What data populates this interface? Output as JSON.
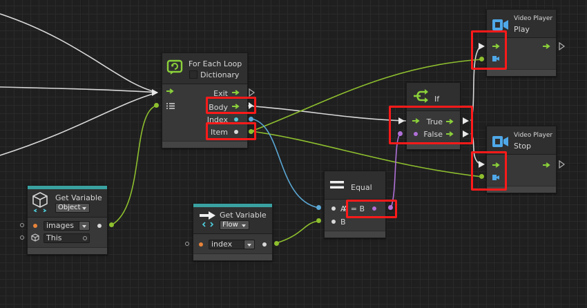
{
  "nodes": {
    "for_each": {
      "title": "For Each Loop",
      "dictionary_label": "Dictionary",
      "exit": "Exit",
      "body": "Body",
      "index": "Index",
      "item": "Item"
    },
    "get_var_object": {
      "title": "Get Variable",
      "kind": "Object",
      "name": "images",
      "target": "This"
    },
    "get_var_flow": {
      "title": "Get Variable",
      "kind": "Flow",
      "name": "index"
    },
    "equal": {
      "title": "Equal",
      "a": "A",
      "b": "B",
      "result": "A = B"
    },
    "if": {
      "title": "If",
      "true_label": "True",
      "false_label": "False"
    },
    "video_play": {
      "subtitle": "Video Player",
      "title": "Play"
    },
    "video_stop": {
      "subtitle": "Video Player",
      "title": "Stop"
    }
  },
  "colors": {
    "control": "#8bd13a",
    "value_green": "#8ebf2e",
    "value_blue": "#5ba8d6",
    "value_purple": "#b070d8",
    "highlight": "#ff1a1a",
    "teal": "#3aa1a1"
  }
}
